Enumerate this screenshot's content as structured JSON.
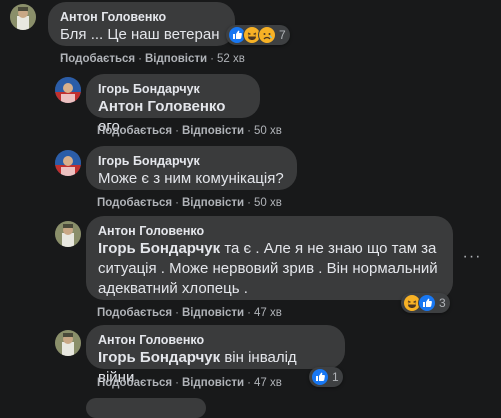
{
  "comments": [
    {
      "author": "Антон Головенко",
      "mention": "",
      "text": "Бля ... Це наш ветеран .",
      "like_label": "Подобається",
      "reply_label": "Відповісти",
      "time": "52 хв",
      "reactions": {
        "icons": [
          "like-icon",
          "haha-icon",
          "sad-icon"
        ],
        "count": "7"
      }
    },
    {
      "author": "Ігорь Бондарчук",
      "mention": "Антон Головенко",
      "text": "ого",
      "like_label": "Подобається",
      "reply_label": "Відповісти",
      "time": "50 хв"
    },
    {
      "author": "Ігорь Бондарчук",
      "mention": "",
      "text": "Може є з ним комунікація?",
      "like_label": "Подобається",
      "reply_label": "Відповісти",
      "time": "50 хв"
    },
    {
      "author": "Антон Головенко",
      "mention": "Ігорь Бондарчук",
      "text_line1": "та є . Але я не знаю що там за",
      "text_line2": "ситуація . Може нервовий зрив . Він нормальний",
      "text_line3": "адекватний хлопець .",
      "like_label": "Подобається",
      "reply_label": "Відповісти",
      "time": "47 хв",
      "reactions": {
        "icons": [
          "haha-icon",
          "like-icon"
        ],
        "count": "3"
      }
    },
    {
      "author": "Антон Головенко",
      "mention": "Ігорь Бондарчук",
      "text": "він інвалід війни",
      "like_label": "Подобається",
      "reply_label": "Відповісти",
      "time": "47 хв",
      "reactions": {
        "icons": [
          "like-icon"
        ],
        "count": "1"
      }
    }
  ],
  "colors": {
    "background": "#18191a",
    "bubble": "#3a3b3c",
    "like_blue": "#1877f2",
    "haha_yellow": "#f7b125"
  }
}
